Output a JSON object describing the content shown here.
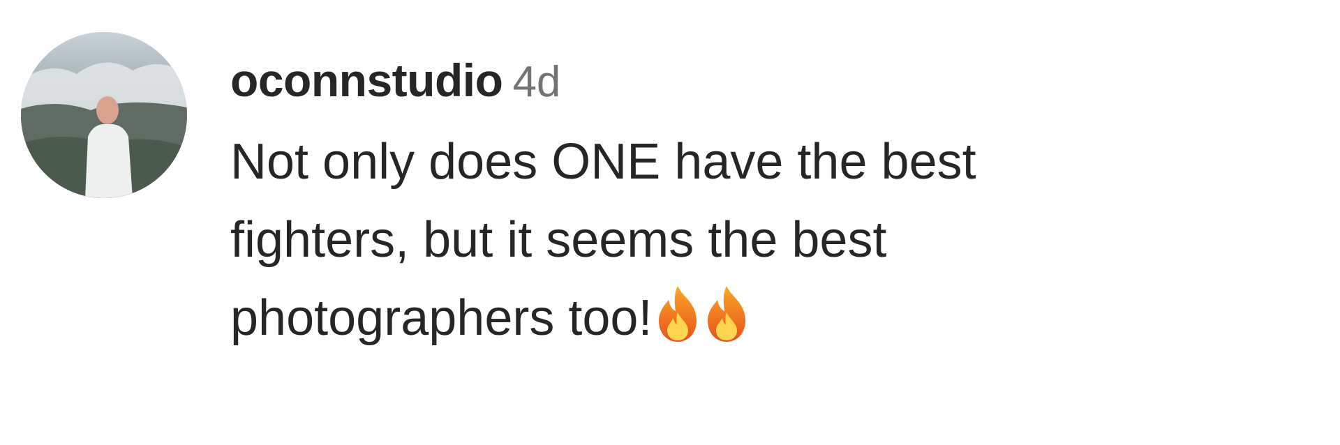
{
  "comment": {
    "username": "oconnstudio",
    "timestamp": "4d",
    "text_lines": [
      "Not only does ONE have the best",
      "fighters, but it seems the best",
      "photographers too!"
    ],
    "emojis": [
      "fire-emoji",
      "fire-emoji"
    ],
    "avatar_icon": "profile-photo"
  },
  "colors": {
    "text": "#262626",
    "muted": "#737373",
    "background": "#ffffff"
  }
}
